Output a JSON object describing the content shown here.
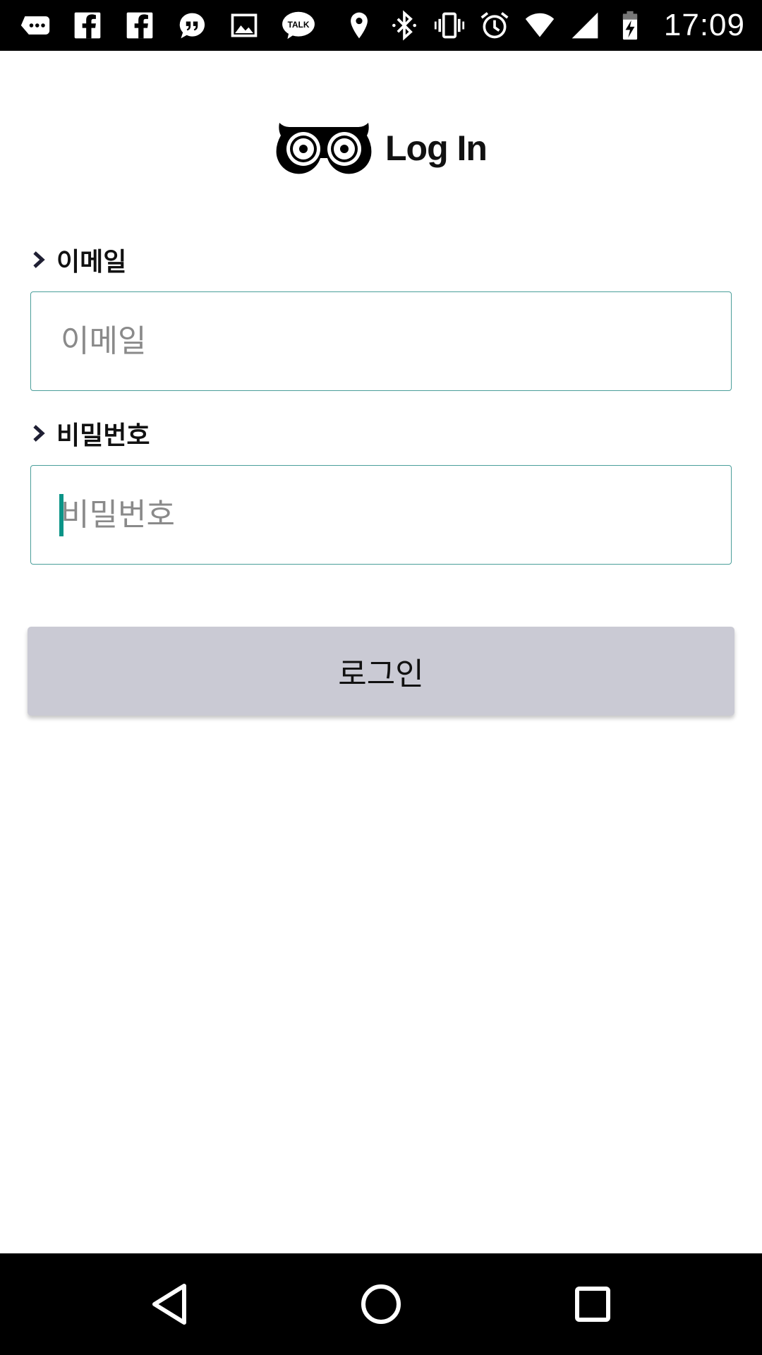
{
  "status_bar": {
    "time": "17:09",
    "left_icons": [
      "chat-more-icon",
      "facebook-icon",
      "facebook-icon",
      "quote-bubble-icon",
      "image-icon",
      "kakao-talk-icon"
    ],
    "talk_badge": "TALK",
    "right_icons": [
      "location-icon",
      "bluetooth-icon",
      "vibrate-icon",
      "alarm-icon",
      "wifi-icon",
      "signal-icon",
      "battery-charging-icon"
    ]
  },
  "header": {
    "logo_icon": "owl-eyes-icon",
    "title": "Log In"
  },
  "form": {
    "email": {
      "label": "이메일",
      "placeholder": "이메일",
      "value": ""
    },
    "password": {
      "label": "비밀번호",
      "placeholder": "비밀번호",
      "value": ""
    },
    "submit_label": "로그인"
  },
  "colors": {
    "input_border": "#4a9e9a",
    "caret": "#0b9487",
    "button_bg": "#cacad4"
  },
  "nav_bar": {
    "buttons": [
      "back-icon",
      "home-icon",
      "recents-icon"
    ]
  }
}
